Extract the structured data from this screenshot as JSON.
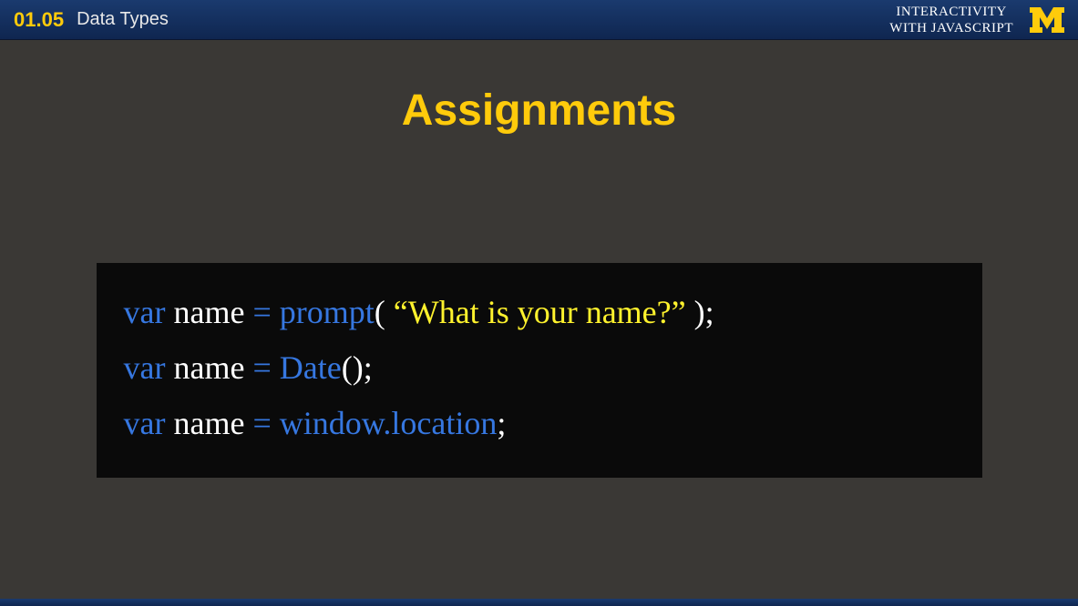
{
  "header": {
    "lesson_number": "01.05",
    "lesson_title": "Data Types",
    "course_title_line1": "INTERACTIVITY",
    "course_title_line2": "WITH JAVASCRIPT"
  },
  "slide": {
    "title": "Assignments"
  },
  "code": {
    "lines": [
      {
        "tokens": [
          {
            "cls": "tok-keyword",
            "t": "var"
          },
          {
            "cls": "tok-ident",
            "t": " name "
          },
          {
            "cls": "tok-op",
            "t": "="
          },
          {
            "cls": "tok-func",
            "t": " prompt"
          },
          {
            "cls": "tok-punct",
            "t": "( "
          },
          {
            "cls": "tok-string",
            "t": "“What is your name?”"
          },
          {
            "cls": "tok-punct",
            "t": " );"
          }
        ]
      },
      {
        "tokens": [
          {
            "cls": "tok-keyword",
            "t": "var"
          },
          {
            "cls": "tok-ident",
            "t": " name "
          },
          {
            "cls": "tok-op",
            "t": "="
          },
          {
            "cls": "tok-func",
            "t": " Date"
          },
          {
            "cls": "tok-punct",
            "t": "();"
          }
        ]
      },
      {
        "tokens": [
          {
            "cls": "tok-keyword",
            "t": "var"
          },
          {
            "cls": "tok-ident",
            "t": " name "
          },
          {
            "cls": "tok-op",
            "t": "="
          },
          {
            "cls": "tok-builtin",
            "t": " window.location"
          },
          {
            "cls": "tok-punct",
            "t": ";"
          }
        ]
      }
    ]
  },
  "colors": {
    "accent_yellow": "#ffcb0b",
    "code_blue": "#3677e0",
    "code_string_yellow": "#fff22d",
    "header_bg": "#0f2650",
    "body_bg": "#3a3835"
  }
}
